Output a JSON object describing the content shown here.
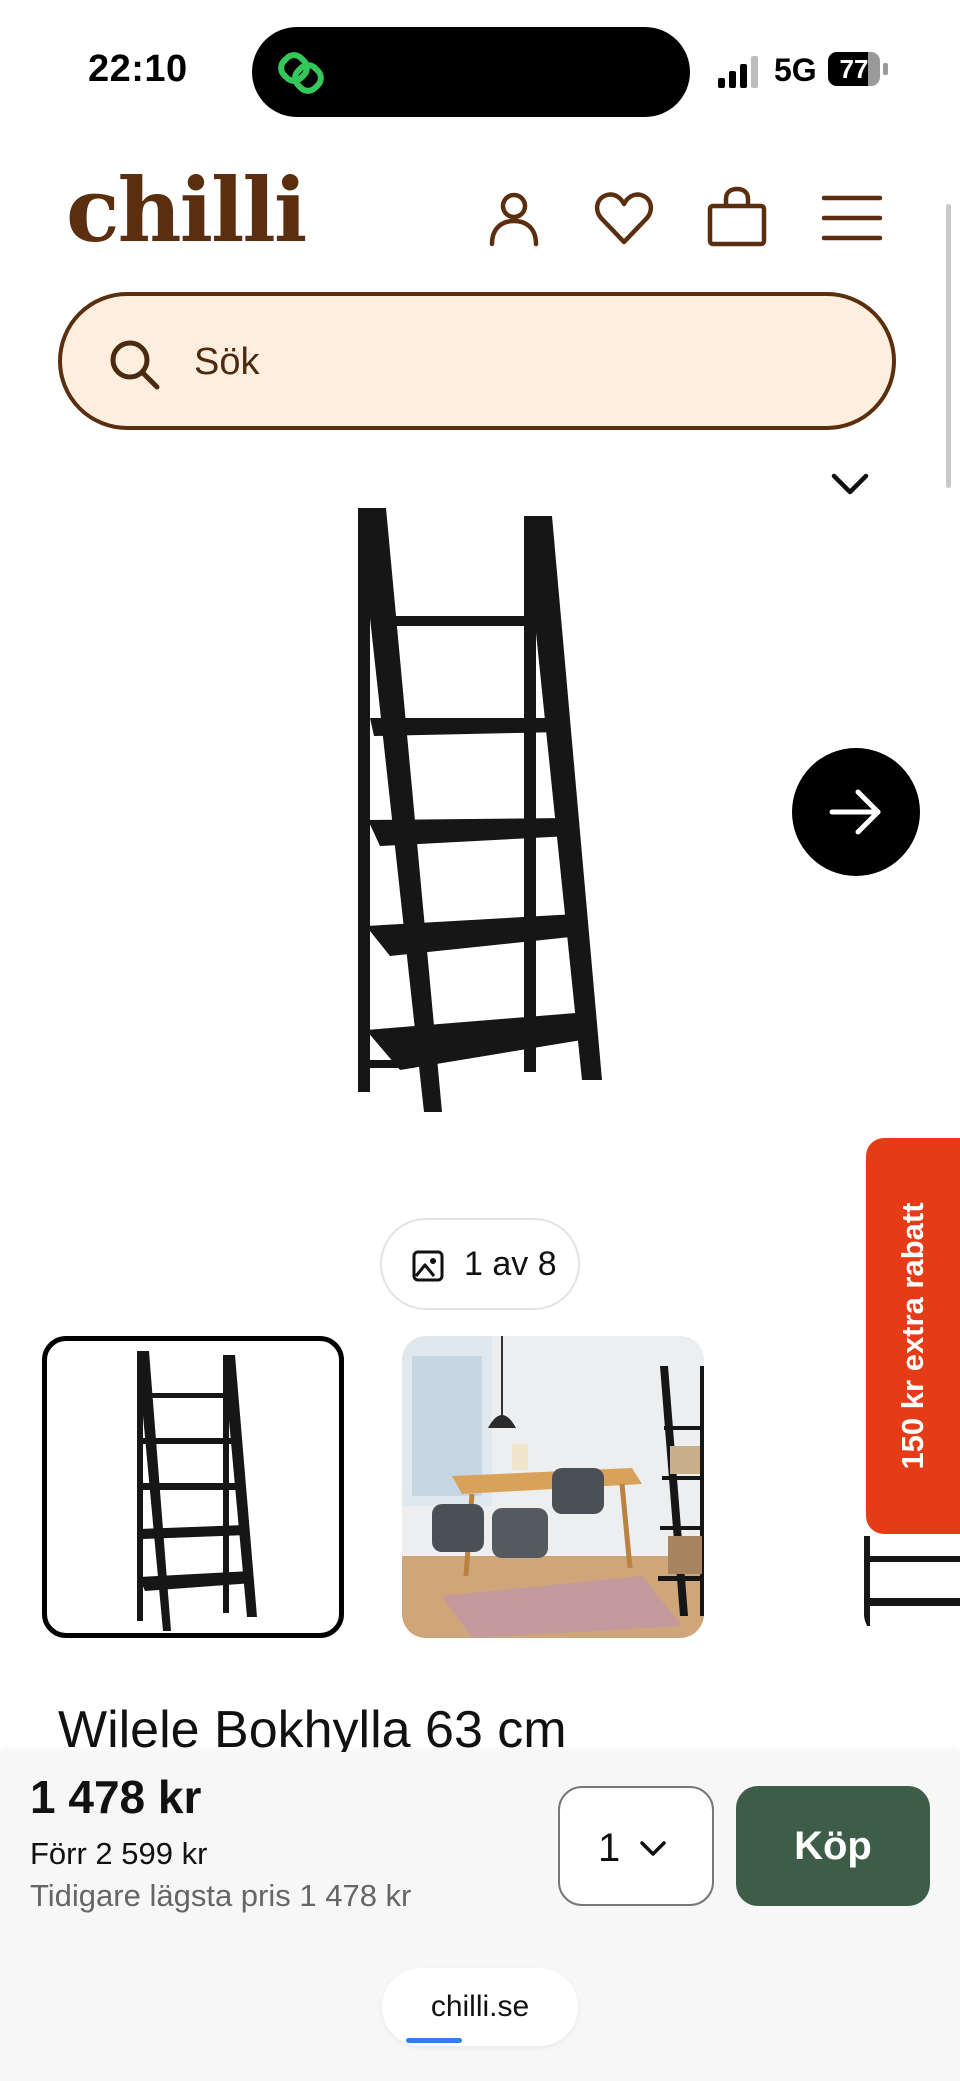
{
  "status_bar": {
    "time": "22:10",
    "network": "5G",
    "battery": "77",
    "battery_level": 0.77
  },
  "header": {
    "logo": "chilli",
    "icons": [
      "account-icon",
      "heart-icon",
      "bag-icon",
      "menu-icon"
    ],
    "brand_color": "#5a2e0e"
  },
  "search": {
    "placeholder": "Sök",
    "background": "#fdeedd"
  },
  "gallery": {
    "counter": "1 av 8"
  },
  "promo": {
    "label": "150 kr extra rabatt",
    "color": "#e53b17"
  },
  "product": {
    "title": "Wilele Bokhylla 63 cm"
  },
  "buybar": {
    "price": "1 478 kr",
    "before": "Förr 2 599 kr",
    "lowest": "Tidigare lägsta pris 1 478 kr",
    "quantity": "1",
    "buy_label": "Köp",
    "buy_color": "#3e5d48"
  },
  "browser": {
    "url": "chilli.se"
  }
}
